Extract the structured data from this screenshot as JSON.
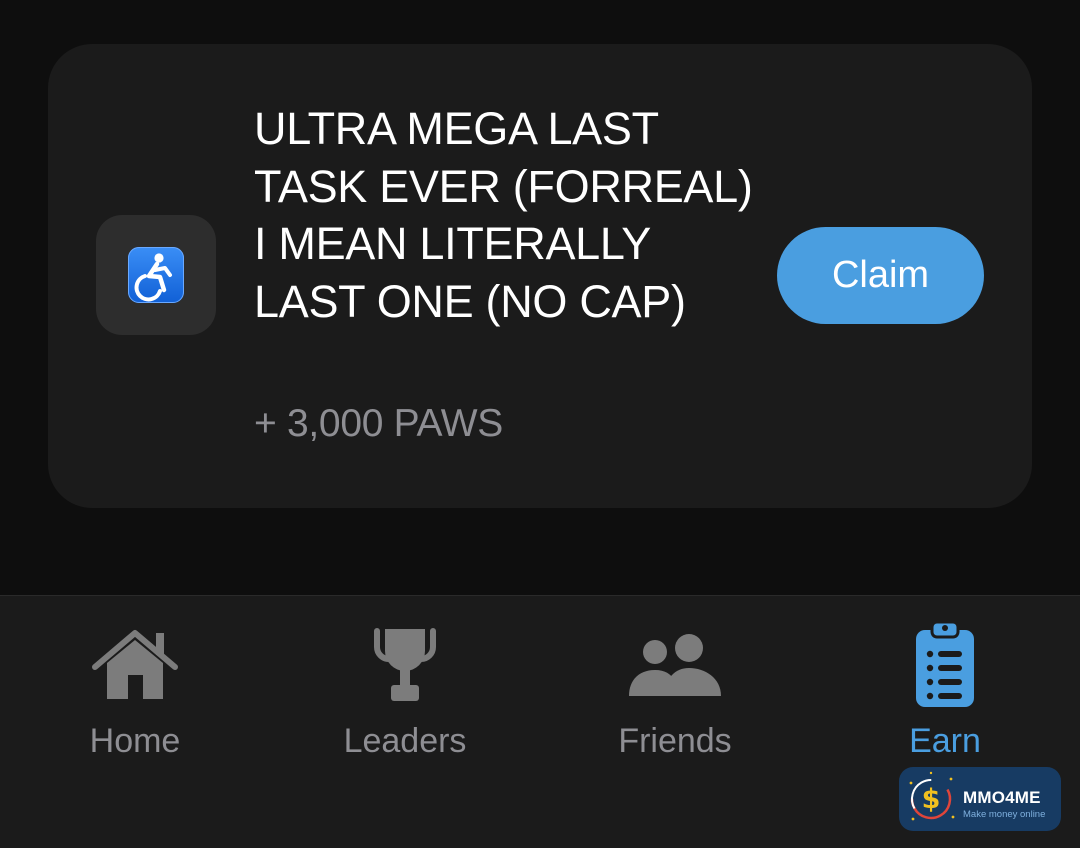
{
  "task": {
    "icon": "accessibility-wheelchair-icon",
    "title": "ULTRA MEGA LAST TASK EVER (FORREAL) I MEAN LITERALLY LAST ONE (NO CAP)",
    "reward": "+ 3,000 PAWS",
    "claim_label": "Claim"
  },
  "nav": {
    "active": "Earn",
    "items": [
      {
        "label": "Home",
        "icon": "home-icon"
      },
      {
        "label": "Leaders",
        "icon": "trophy-icon"
      },
      {
        "label": "Friends",
        "icon": "friends-icon"
      },
      {
        "label": "Earn",
        "icon": "clipboard-list-icon"
      }
    ]
  },
  "watermark": {
    "brand": "MMO4ME",
    "tagline": "Make money online"
  },
  "colors": {
    "background": "#0e0e0e",
    "card": "#1b1b1b",
    "accent": "#4a9ee0",
    "muted_text": "#8e8e93",
    "inactive_icon": "#7c7c7c"
  }
}
